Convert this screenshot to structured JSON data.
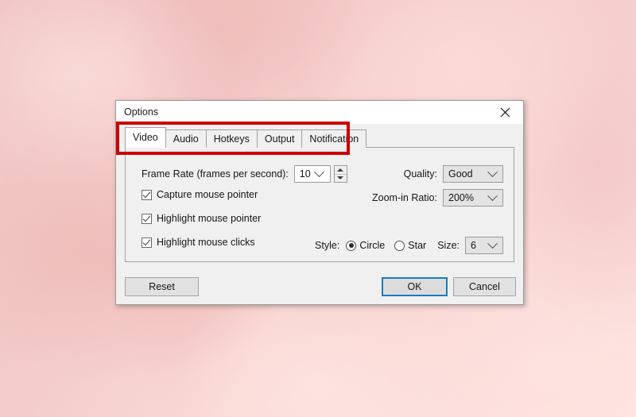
{
  "window": {
    "title": "Options",
    "close_icon": "close-x-icon"
  },
  "tabs": [
    {
      "label": "Video",
      "active": true
    },
    {
      "label": "Audio",
      "active": false
    },
    {
      "label": "Hotkeys",
      "active": false
    },
    {
      "label": "Output",
      "active": false
    },
    {
      "label": "Notification",
      "active": false
    }
  ],
  "video_tab": {
    "frame_rate": {
      "label": "Frame Rate (frames per second):",
      "value": "10",
      "dropdown_icon": "chevron-down-icon",
      "spinner_up_icon": "triangle-up-icon",
      "spinner_down_icon": "triangle-down-icon"
    },
    "quality": {
      "label": "Quality:",
      "value": "Good",
      "dropdown_icon": "chevron-down-icon"
    },
    "zoom_in_ratio": {
      "label": "Zoom-in Ratio:",
      "value": "200%",
      "dropdown_icon": "chevron-down-icon"
    },
    "checkboxes": [
      {
        "label": "Capture mouse pointer",
        "checked": true
      },
      {
        "label": "Highlight mouse pointer",
        "checked": true
      },
      {
        "label": "Highlight mouse clicks",
        "checked": true
      }
    ],
    "style": {
      "label": "Style:",
      "options": [
        {
          "label": "Circle",
          "selected": true
        },
        {
          "label": "Star",
          "selected": false
        }
      ]
    },
    "size": {
      "label": "Size:",
      "value": "6",
      "dropdown_icon": "chevron-down-icon"
    }
  },
  "footer": {
    "reset": "Reset",
    "ok": "OK",
    "cancel": "Cancel"
  },
  "annotation": {
    "type": "highlight-rectangle",
    "color": "#cc0000",
    "target": "tab-strip"
  },
  "colors": {
    "accent_focus": "#1a7bc4",
    "annotation_red": "#cc0000",
    "dialog_bg": "#f0f0f0",
    "background_pink": "#f3c5c2"
  }
}
